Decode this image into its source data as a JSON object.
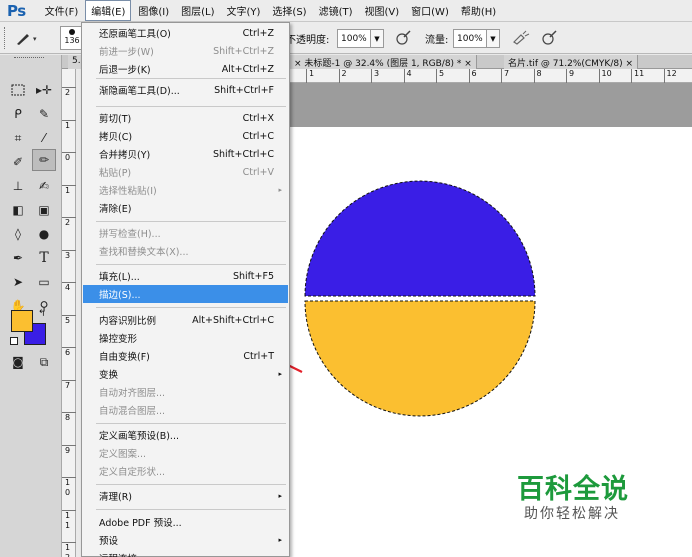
{
  "app": {
    "logo": "Ps"
  },
  "menubar": [
    {
      "label": "文件(F)"
    },
    {
      "label": "编辑(E)"
    },
    {
      "label": "图像(I)"
    },
    {
      "label": "图层(L)"
    },
    {
      "label": "文字(Y)"
    },
    {
      "label": "选择(S)"
    },
    {
      "label": "滤镜(T)"
    },
    {
      "label": "视图(V)"
    },
    {
      "label": "窗口(W)"
    },
    {
      "label": "帮助(H)"
    }
  ],
  "options": {
    "brush_size": "136",
    "opacity_label": "不透明度:",
    "opacity_value": "100%",
    "flow_label": "流量:",
    "flow_value": "100%"
  },
  "tabs": [
    {
      "label": "5."
    },
    {
      "label": "未标题-1 @ 32.4% (图层 1, RGB/8) *"
    },
    {
      "label": "名片.tif @ 71.2%(CMYK/8)"
    }
  ],
  "tab_close": "×",
  "hruler": [
    "1",
    "2",
    "3",
    "4",
    "5",
    "6",
    "7",
    "8",
    "9",
    "10",
    "11",
    "12"
  ],
  "vruler": [
    "2",
    "1",
    "0",
    "1",
    "2",
    "3",
    "4",
    "5",
    "6",
    "7",
    "8",
    "9",
    "1 0",
    "1 1",
    "1 2"
  ],
  "edit_menu": [
    {
      "label": "还原画笔工具(O)",
      "shortcut": "Ctrl+Z"
    },
    {
      "label": "前进一步(W)",
      "shortcut": "Shift+Ctrl+Z"
    },
    {
      "label": "后退一步(K)",
      "shortcut": "Alt+Ctrl+Z"
    },
    {
      "label": "渐隐画笔工具(D)...",
      "shortcut": "Shift+Ctrl+F"
    },
    {
      "label": "剪切(T)",
      "shortcut": "Ctrl+X"
    },
    {
      "label": "拷贝(C)",
      "shortcut": "Ctrl+C"
    },
    {
      "label": "合并拷贝(Y)",
      "shortcut": "Shift+Ctrl+C"
    },
    {
      "label": "粘贴(P)",
      "shortcut": "Ctrl+V"
    },
    {
      "label": "选择性粘贴(I)",
      "shortcut": "▸"
    },
    {
      "label": "清除(E)",
      "shortcut": ""
    },
    {
      "label": "拼写检查(H)...",
      "shortcut": ""
    },
    {
      "label": "查找和替换文本(X)...",
      "shortcut": ""
    },
    {
      "label": "填充(L)...",
      "shortcut": "Shift+F5"
    },
    {
      "label": "描边(S)...",
      "shortcut": ""
    },
    {
      "label": "内容识别比例",
      "shortcut": "Alt+Shift+Ctrl+C"
    },
    {
      "label": "操控变形",
      "shortcut": ""
    },
    {
      "label": "自由变换(F)",
      "shortcut": "Ctrl+T"
    },
    {
      "label": "变换",
      "shortcut": "▸"
    },
    {
      "label": "自动对齐图层...",
      "shortcut": ""
    },
    {
      "label": "自动混合图层...",
      "shortcut": ""
    },
    {
      "label": "定义画笔预设(B)...",
      "shortcut": ""
    },
    {
      "label": "定义图案...",
      "shortcut": ""
    },
    {
      "label": "定义自定形状...",
      "shortcut": ""
    },
    {
      "label": "清理(R)",
      "shortcut": "▸"
    },
    {
      "label": "Adobe PDF 预设...",
      "shortcut": ""
    },
    {
      "label": "预设",
      "shortcut": "▸"
    },
    {
      "label": "远程连接...",
      "shortcut": ""
    }
  ],
  "colors": {
    "foreground": "#fbbf30",
    "background": "#3a1ee6",
    "circle_top": "#3a1ee6",
    "circle_bottom": "#fbbf30",
    "arrow": "#e3202a",
    "highlight": "#3b8fe8"
  },
  "watermark": {
    "title": "百科全说",
    "subtitle": "助你轻松解决"
  }
}
